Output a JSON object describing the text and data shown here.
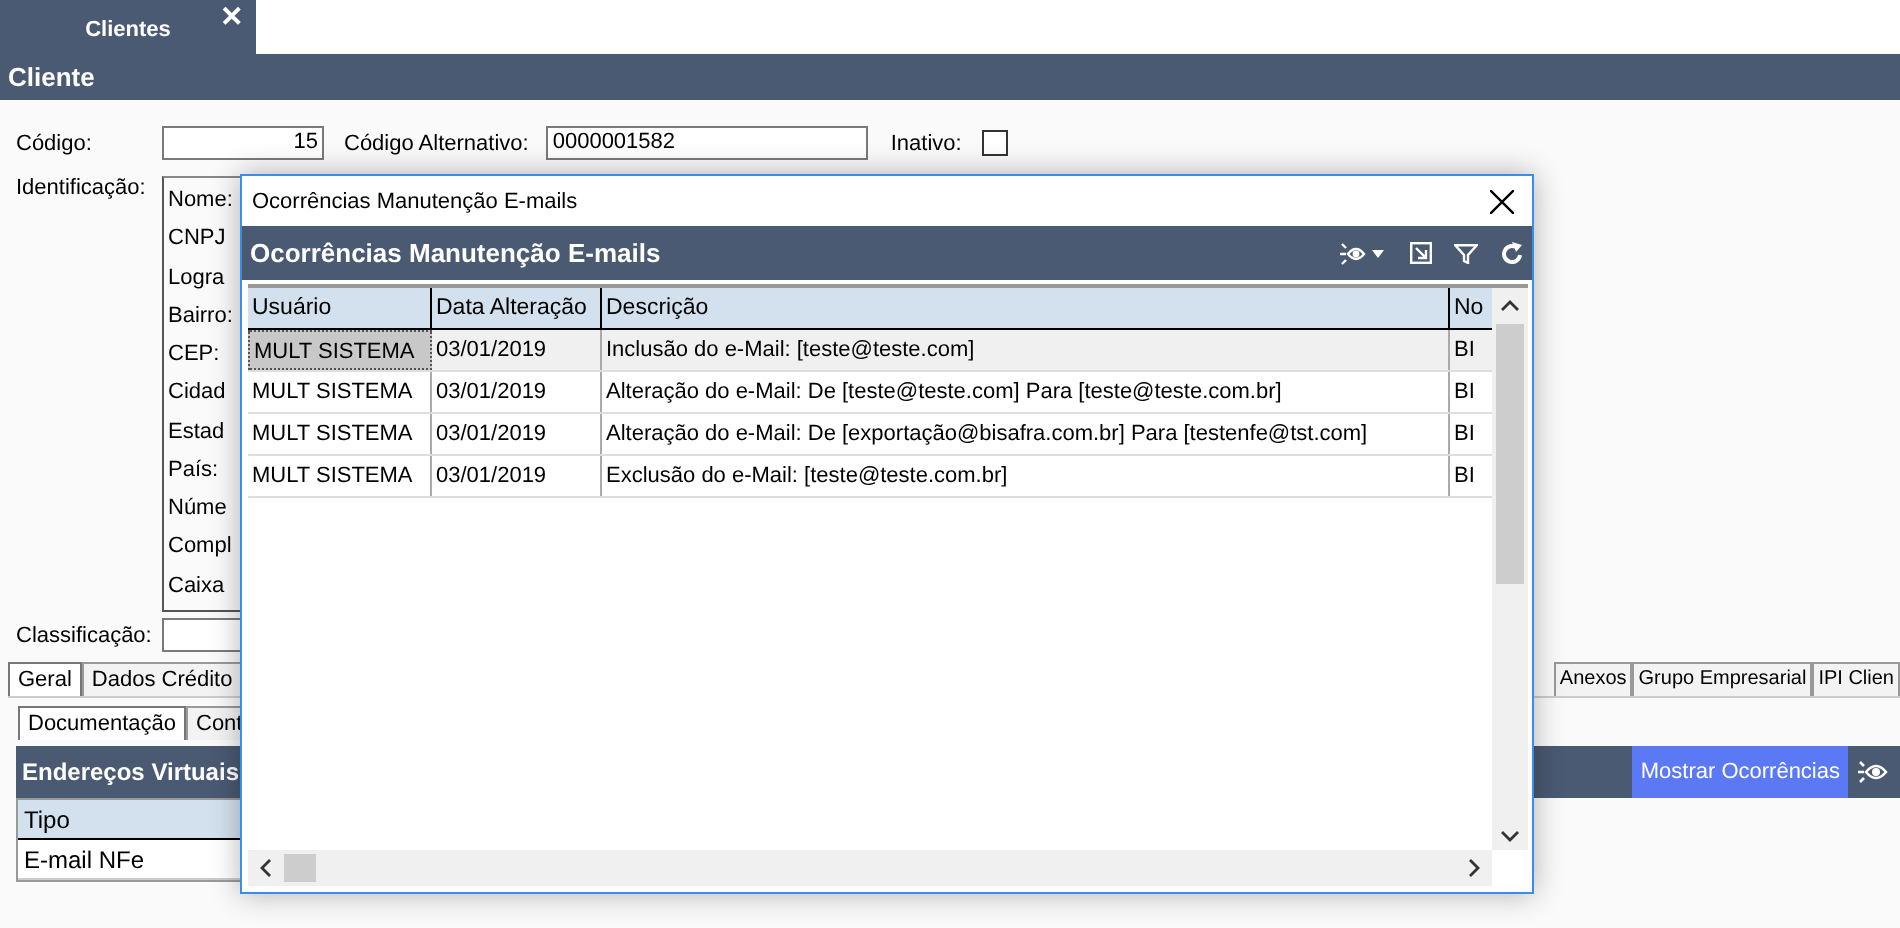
{
  "tab": {
    "label": "Clientes",
    "close": "✕"
  },
  "header": "Cliente",
  "form": {
    "codigo_label": "Código:",
    "codigo": "15",
    "alt_label": "Código Alternativo:",
    "alt": "0000001582",
    "inativo_label": "Inativo:",
    "inativo": false,
    "ident_label": "Identificação:",
    "ident_fields": [
      "Nome:",
      "CNPJ",
      "Logra",
      "Bairro:",
      "CEP:",
      "Cidad",
      "Estad",
      "País:",
      "Núme",
      "Compl",
      "Caixa"
    ],
    "class_label": "Classificação:"
  },
  "tabs_left": [
    {
      "label": "Geral",
      "selected": true
    },
    {
      "label": "Dados Crédito",
      "selected": false
    }
  ],
  "tabs_right": [
    {
      "label": "Anexos",
      "selected": false
    },
    {
      "label": "Grupo Empresarial",
      "selected": false
    },
    {
      "label": "IPI Clien",
      "selected": false
    }
  ],
  "subtabs": [
    {
      "label": "Documentação",
      "selected": true
    },
    {
      "label": "Cont",
      "selected": false
    }
  ],
  "grid": {
    "title": "Endereços Virtuais",
    "button": "Mostrar Ocorrências",
    "columns": [
      "Tipo"
    ],
    "rows": [
      [
        "E-mail NFe"
      ]
    ]
  },
  "dialog": {
    "title": "Ocorrências Manutenção E-mails",
    "header": "Ocorrências Manutenção E-mails",
    "columns": [
      "Usuário",
      "Data Alteração",
      "Descrição",
      "No"
    ],
    "rows": [
      {
        "cells": [
          "MULT SISTEMA",
          "03/01/2019",
          "Inclusão do e-Mail: [teste@teste.com]",
          "BI"
        ],
        "selected": true
      },
      {
        "cells": [
          "MULT SISTEMA",
          "03/01/2019",
          "Alteração do e-Mail: De [teste@teste.com] Para [teste@teste.com.br]",
          "BI"
        ],
        "selected": false
      },
      {
        "cells": [
          "MULT SISTEMA",
          "03/01/2019",
          "Alteração do e-Mail: De [exportação@bisafra.com.br] Para [testenfe@tst.com]",
          "BI"
        ],
        "selected": false
      },
      {
        "cells": [
          "MULT SISTEMA",
          "03/01/2019",
          "Exclusão do e-Mail: [teste@teste.com.br]",
          "BI"
        ],
        "selected": false
      }
    ]
  }
}
